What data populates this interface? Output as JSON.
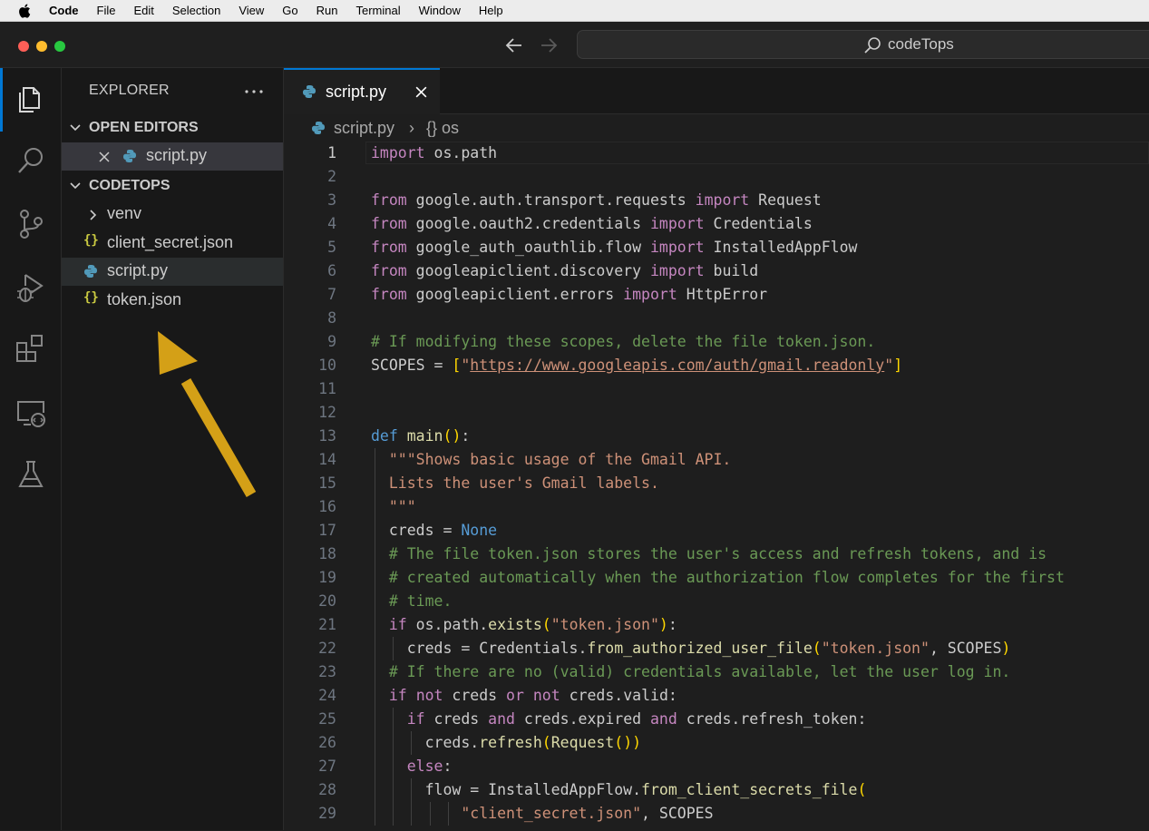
{
  "menubar": {
    "items": [
      "Code",
      "File",
      "Edit",
      "Selection",
      "View",
      "Go",
      "Run",
      "Terminal",
      "Window",
      "Help"
    ]
  },
  "window": {
    "search_label": "codeTops"
  },
  "sidebar": {
    "title": "EXPLORER",
    "open_editors_label": "OPEN EDITORS",
    "open_editor_file": "script.py",
    "folder_label": "CODETOPS",
    "tree": [
      {
        "name": "venv",
        "type": "folder"
      },
      {
        "name": "client_secret.json",
        "type": "json"
      },
      {
        "name": "script.py",
        "type": "python"
      },
      {
        "name": "token.json",
        "type": "json"
      }
    ]
  },
  "editor": {
    "tab_label": "script.py",
    "breadcrumb": {
      "file": "script.py",
      "symbol": "{} os"
    },
    "current_line": 1,
    "lines": [
      "import os.path",
      "",
      "from google.auth.transport.requests import Request",
      "from google.oauth2.credentials import Credentials",
      "from google_auth_oauthlib.flow import InstalledAppFlow",
      "from googleapiclient.discovery import build",
      "from googleapiclient.errors import HttpError",
      "",
      "# If modifying these scopes, delete the file token.json.",
      "SCOPES = [\"https://www.googleapis.com/auth/gmail.readonly\"]",
      "",
      "",
      "def main():",
      "  \"\"\"Shows basic usage of the Gmail API.",
      "  Lists the user's Gmail labels.",
      "  \"\"\"",
      "  creds = None",
      "  # The file token.json stores the user's access and refresh tokens, and is",
      "  # created automatically when the authorization flow completes for the first",
      "  # time.",
      "  if os.path.exists(\"token.json\"):",
      "    creds = Credentials.from_authorized_user_file(\"token.json\", SCOPES)",
      "  # If there are no (valid) credentials available, let the user log in.",
      "  if not creds or not creds.valid:",
      "    if creds and creds.expired and creds.refresh_token:",
      "      creds.refresh(Request())",
      "    else:",
      "      flow = InstalledAppFlow.from_client_secrets_file(",
      "          \"client_secret.json\", SCOPES"
    ]
  },
  "colors": {
    "accent": "#0078d4",
    "annotation_arrow": "#d4a017"
  },
  "icons": {
    "activity_bar": [
      "files-icon",
      "search-icon",
      "source-control-icon",
      "run-debug-icon",
      "extensions-icon",
      "remote-explorer-icon",
      "testing-icon"
    ]
  }
}
